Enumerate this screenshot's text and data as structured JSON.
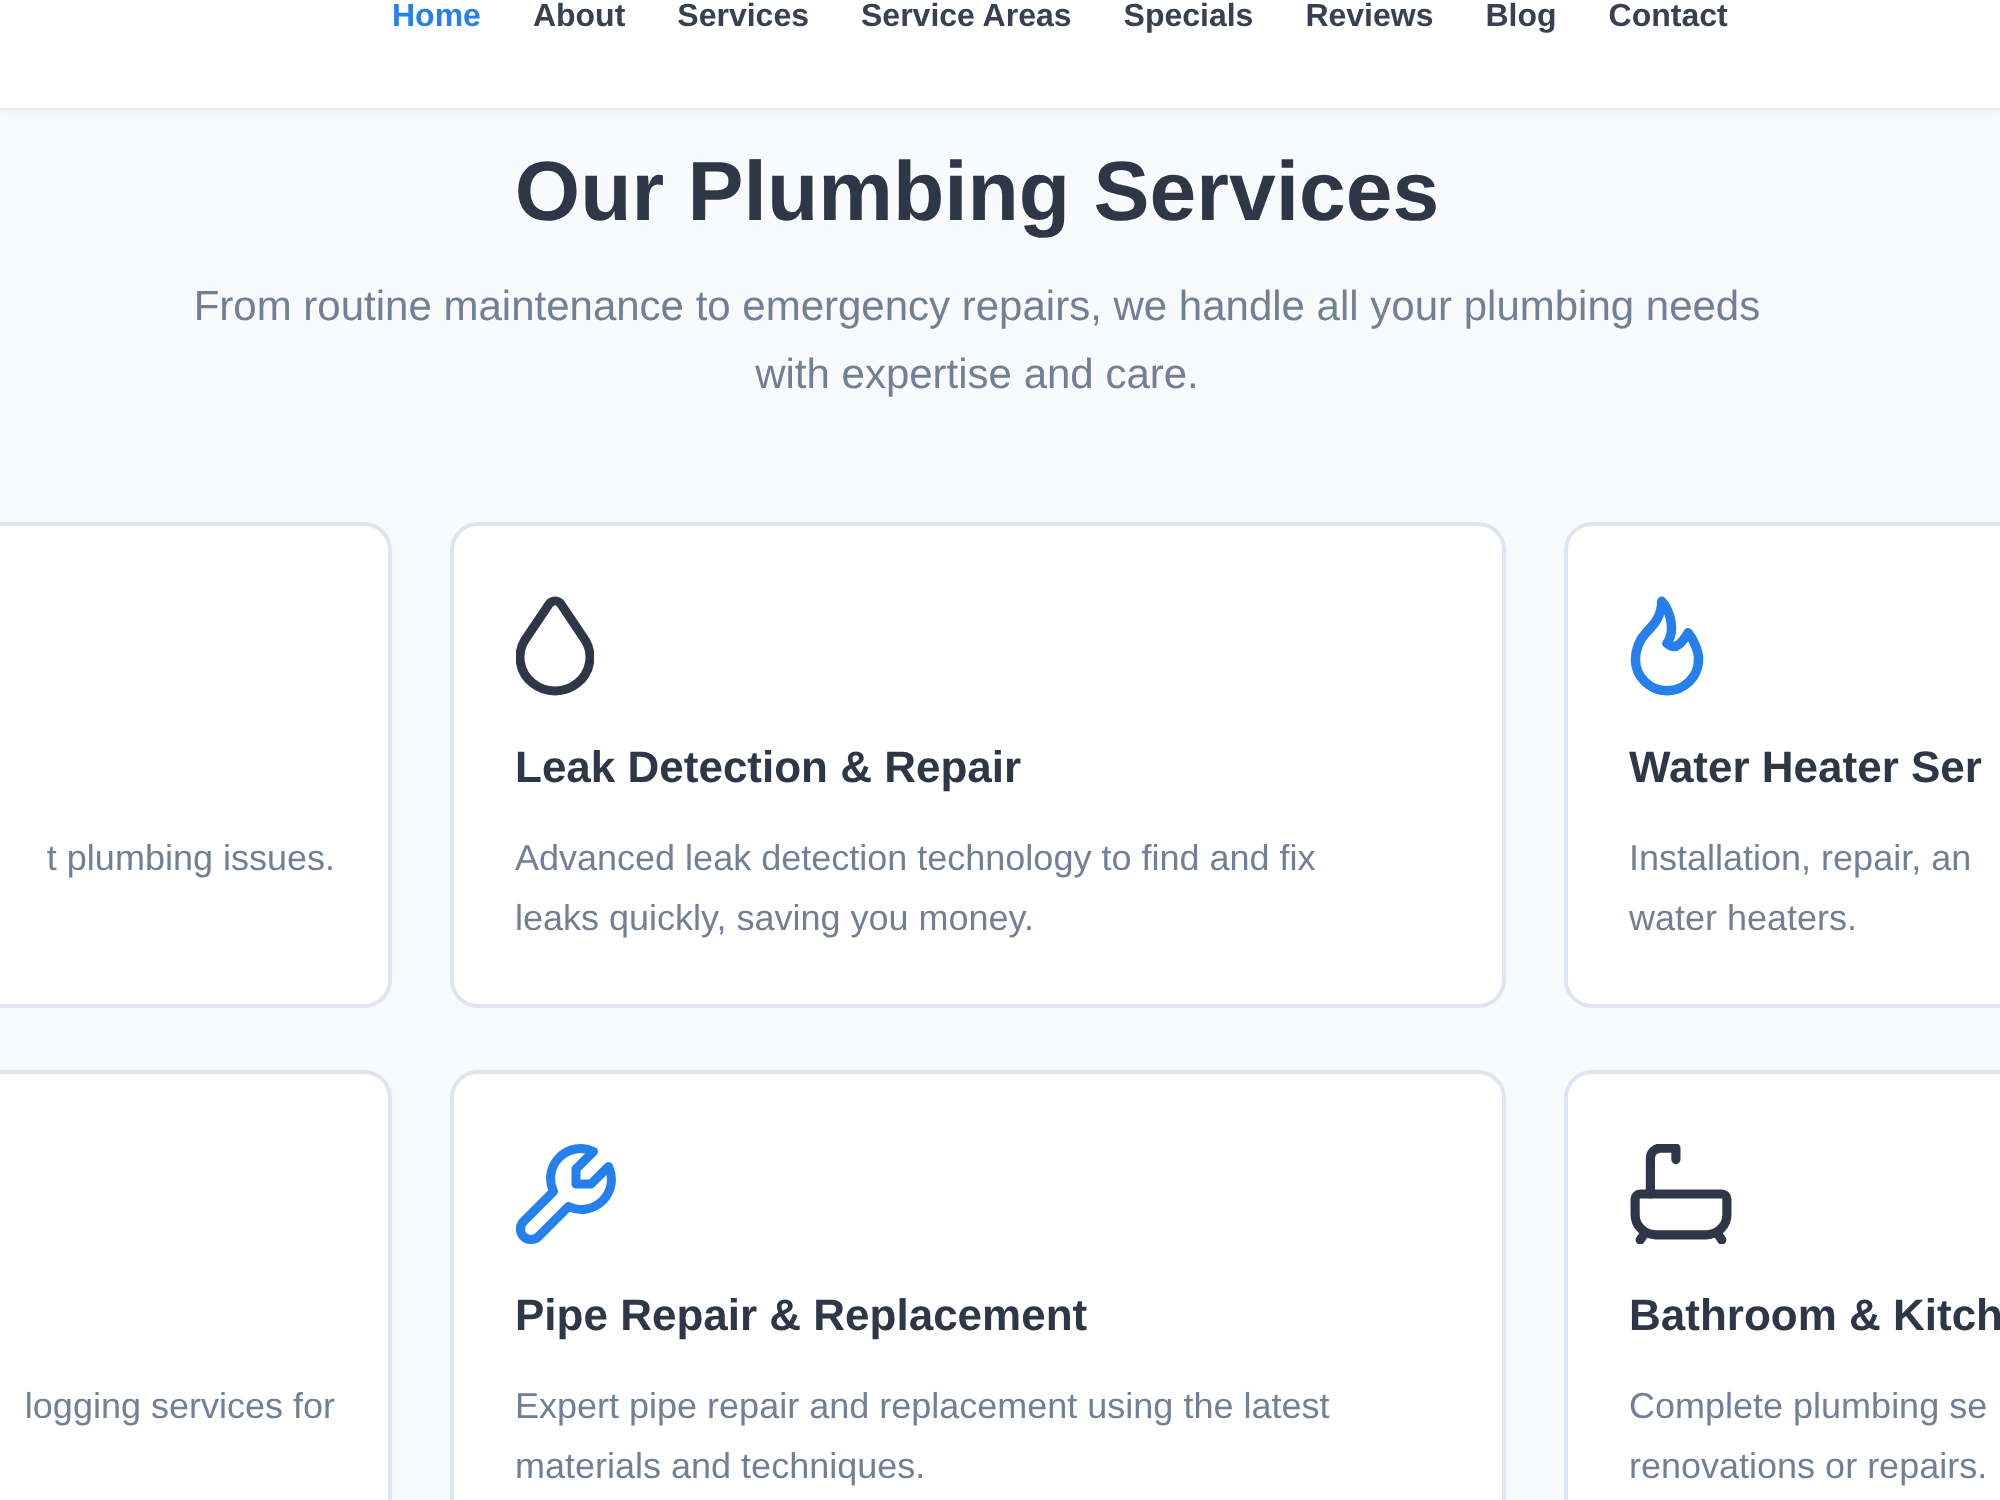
{
  "nav": {
    "items": [
      {
        "label": "Home",
        "selected": true
      },
      {
        "label": "About",
        "selected": false
      },
      {
        "label": "Services",
        "selected": false
      },
      {
        "label": "Service Areas",
        "selected": false
      },
      {
        "label": "Specials",
        "selected": false
      },
      {
        "label": "Reviews",
        "selected": false
      },
      {
        "label": "Blog",
        "selected": false
      },
      {
        "label": "Contact",
        "selected": false
      }
    ]
  },
  "services": {
    "title": "Our Plumbing Services",
    "subtitle": "From routine maintenance to emergency repairs, we handle all your plumbing needs with expertise and care.",
    "cards": [
      {
        "kind": "cropped",
        "description_lines": [
          "t plumbing issues."
        ]
      },
      {
        "kind": "full",
        "color": "#2d3748",
        "title": "Leak Detection & Repair",
        "description": "Advanced leak detection technology to find and fix leaks quickly, saving you money."
      },
      {
        "kind": "full",
        "color": "#2680eb",
        "title": "Water Heater Ser",
        "description_lines": [
          "Installation, repair, an",
          "water heaters."
        ]
      },
      {
        "kind": "cropped",
        "description_lines": [
          "logging services for"
        ]
      },
      {
        "kind": "full",
        "color": "#2680eb",
        "title": "Pipe Repair & Replacement",
        "description": "Expert pipe repair and replacement using the latest materials and techniques."
      },
      {
        "kind": "full",
        "color": "#2d3748",
        "title": "Bathroom & Kitch",
        "description_lines": [
          "Complete plumbing se",
          "renovations or repairs."
        ]
      }
    ]
  }
}
